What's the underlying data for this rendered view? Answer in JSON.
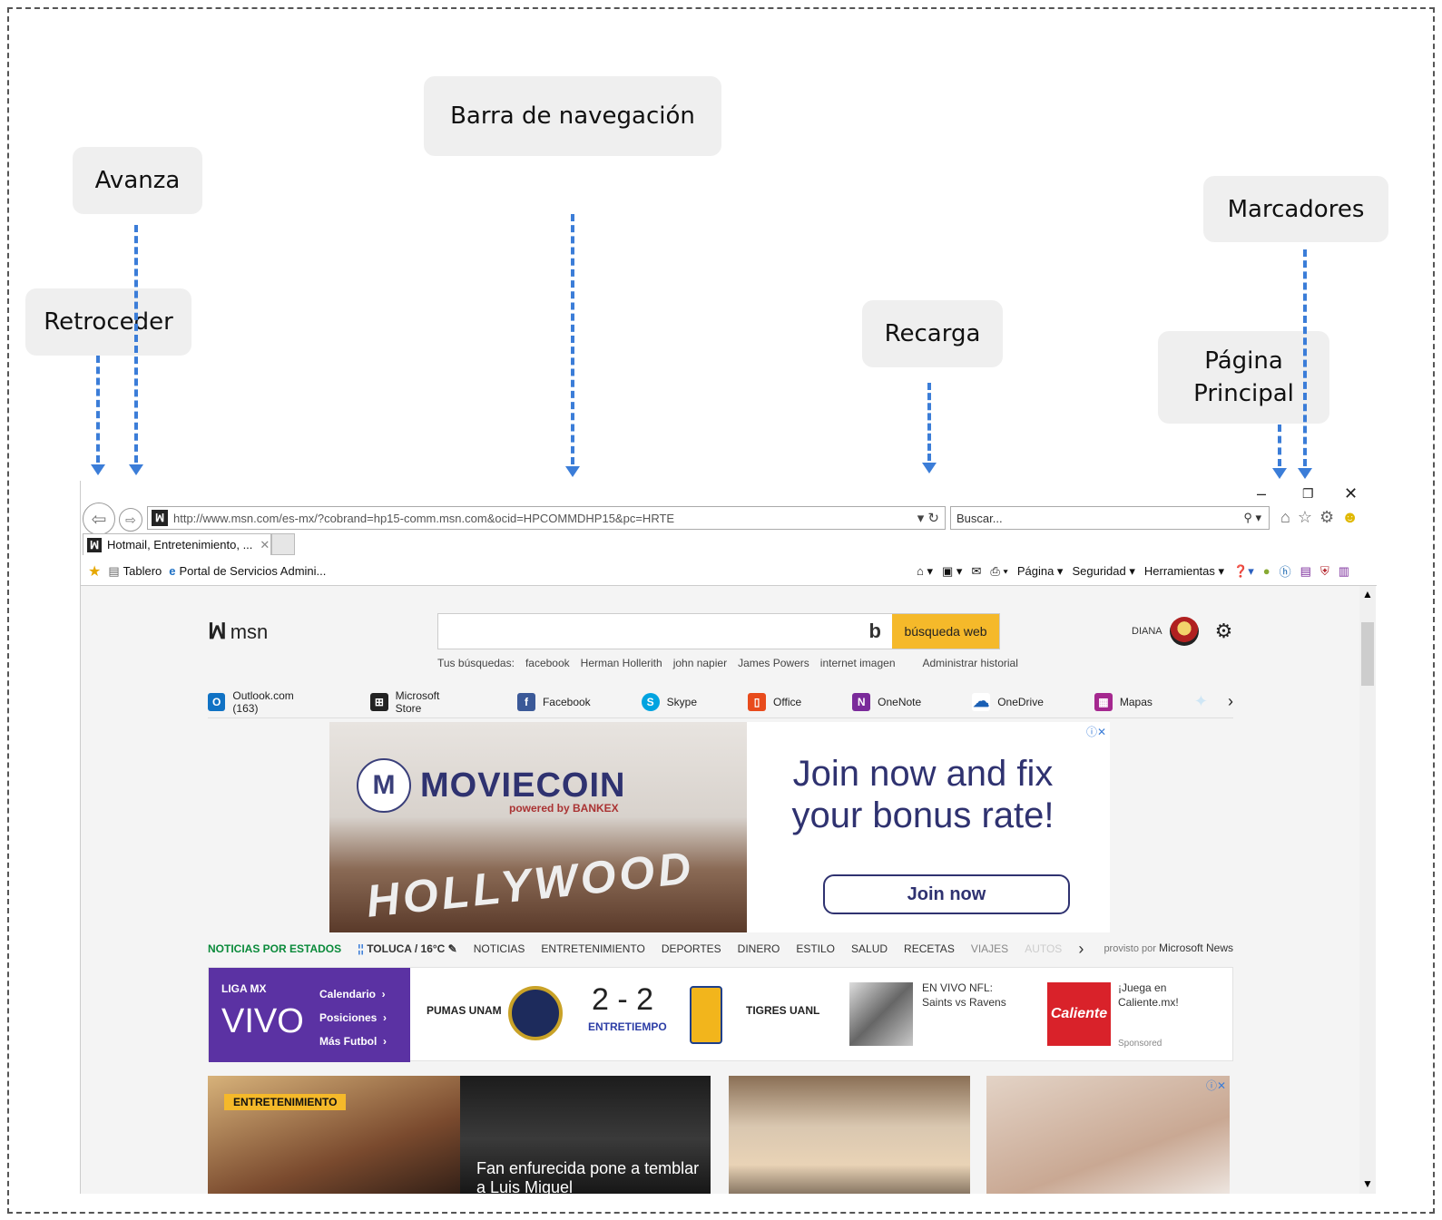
{
  "annotations": {
    "retroceder": "Retroceder",
    "avanza": "Avanza",
    "barra": "Barra de navegación",
    "recarga": "Recarga",
    "marcadores": "Marcadores",
    "pagina": "Página Principal"
  },
  "browser": {
    "url": "http://www.msn.com/es-mx/?cobrand=hp15-comm.msn.com&ocid=HPCOMMDHP15&pc=HRTE",
    "search_placeholder": "Buscar...",
    "tab_title": "Hotmail, Entretenimiento, ...",
    "favorites": [
      "Tablero",
      "Portal de Servicios Admini..."
    ],
    "commands": [
      "Página",
      "Seguridad",
      "Herramientas"
    ]
  },
  "msn": {
    "logo": "msn",
    "search_button": "búsqueda web",
    "recent_label": "Tus búsquedas:",
    "recent": [
      "facebook",
      "Herman Hollerith",
      "john napier",
      "James Powers",
      "internet imagen"
    ],
    "manage_history": "Administrar historial",
    "user": "DIANA",
    "quicklinks": [
      "Outlook.com (163)",
      "Microsoft Store",
      "Facebook",
      "Skype",
      "Office",
      "OneNote",
      "OneDrive",
      "Mapas"
    ]
  },
  "ad": {
    "brand": "MOVIECOIN",
    "sub": "powered by BANKEX",
    "sign": "HOLLYWOOD",
    "headline": "Join now and fix your bonus rate!",
    "cta": "Join now"
  },
  "newsbar": {
    "states": "NOTICIAS POR ESTADOS",
    "weather": "TOLUCA / 16°C",
    "nav": [
      "NOTICIAS",
      "ENTRETENIMIENTO",
      "DEPORTES",
      "DINERO",
      "ESTILO",
      "SALUD",
      "RECETAS",
      "VIAJES",
      "AUTOS"
    ],
    "provider_label": "provisto por",
    "provider": "Microsoft News"
  },
  "scores": {
    "league": "LIGA MX",
    "live": "VIVO",
    "links": [
      "Calendario",
      "Posiciones",
      "Más Futbol"
    ],
    "home": "PUMAS UNAM",
    "away": "TIGRES UANL",
    "score": "2 - 2",
    "status": "ENTRETIEMPO",
    "nfl": "EN VIVO NFL: Saints vs Ravens",
    "promo": "¡Juega en Caliente.mx!",
    "sponsored": "Sponsored",
    "caliente_logo": "Caliente"
  },
  "cards": {
    "tag": "ENTRETENIMIENTO",
    "headline": "Fan enfurecida pone a temblar a Luis Miguel"
  }
}
